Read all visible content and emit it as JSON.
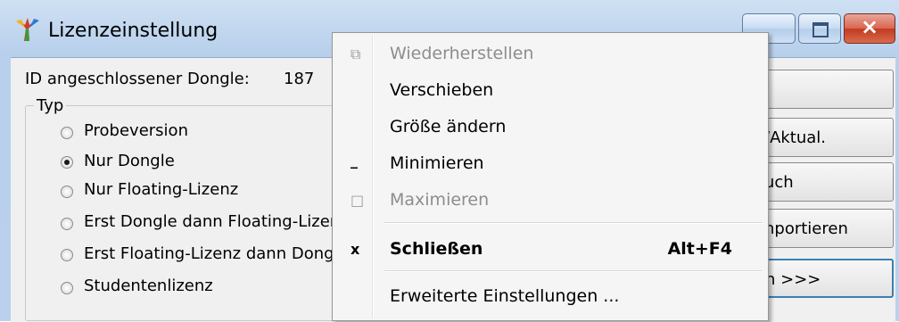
{
  "window": {
    "title": "Lizenzeinstellung",
    "controls": {
      "minimize": "minimize",
      "maximize": "maximize",
      "close": "close"
    }
  },
  "dongle": {
    "label": "ID angeschlossener Dongle:",
    "value": "187"
  },
  "license_type": {
    "group_label": "Typ",
    "options": [
      {
        "label": "Probeversion",
        "selected": false
      },
      {
        "label": "Nur Dongle",
        "selected": true
      },
      {
        "label": "Nur Floating-Lizenz",
        "selected": false
      },
      {
        "label": "Erst Dongle dann Floating-Lizer",
        "selected": false
      },
      {
        "label": "Erst Floating-Lizenz dann Dong",
        "selected": false
      },
      {
        "label": "Studentenlizenz",
        "selected": false
      }
    ]
  },
  "right_buttons": [
    {
      "label": ""
    },
    {
      "label": "/Aktual."
    },
    {
      "label": "uch"
    },
    {
      "label": "nportieren"
    },
    {
      "label": "n >>>"
    }
  ],
  "context_menu": {
    "items": [
      {
        "label": "Wiederherstellen",
        "icon": "restore-icon",
        "disabled": true
      },
      {
        "label": "Verschieben",
        "disabled": false
      },
      {
        "label": "Größe ändern",
        "disabled": false
      },
      {
        "label": "Minimieren",
        "icon": "minimize-icon",
        "disabled": false
      },
      {
        "label": "Maximieren",
        "icon": "maximize-icon",
        "disabled": true
      },
      {
        "label": "Schließen",
        "icon": "close-icon",
        "shortcut": "Alt+F4",
        "disabled": false,
        "bold": true
      },
      {
        "label": "Erweiterte Einstellungen ...",
        "disabled": false
      }
    ]
  },
  "colors": {
    "close_button": "#d9654f",
    "titlebar": "#cfe0f3"
  }
}
